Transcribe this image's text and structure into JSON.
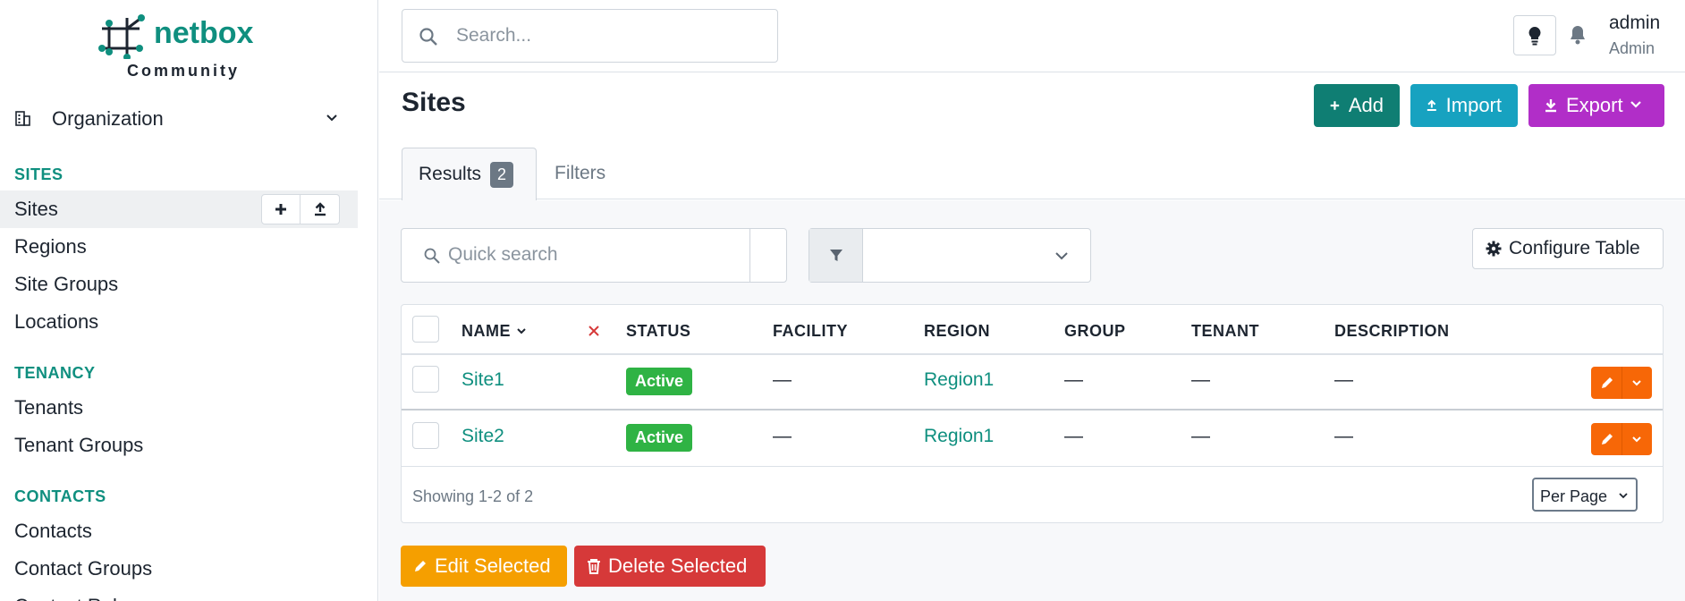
{
  "brand": {
    "name": "netbox",
    "edition": "Community"
  },
  "sidebar": {
    "org_label": "Organization",
    "sections": [
      {
        "title": "SITES",
        "items": [
          "Sites",
          "Regions",
          "Site Groups",
          "Locations"
        ]
      },
      {
        "title": "TENANCY",
        "items": [
          "Tenants",
          "Tenant Groups"
        ]
      },
      {
        "title": "CONTACTS",
        "items": [
          "Contacts",
          "Contact Groups",
          "Contact Roles"
        ]
      }
    ],
    "active_item": "Sites"
  },
  "header": {
    "search_placeholder": "Search...",
    "user_name": "admin",
    "user_role": "Admin"
  },
  "page": {
    "title": "Sites",
    "add_label": "Add",
    "import_label": "Import",
    "export_label": "Export",
    "tab_results": "Results",
    "results_count": "2",
    "tab_filters": "Filters"
  },
  "controls": {
    "quick_search_placeholder": "Quick search",
    "configure_label": "Configure Table"
  },
  "table": {
    "columns": [
      "NAME",
      "STATUS",
      "FACILITY",
      "REGION",
      "GROUP",
      "TENANT",
      "DESCRIPTION"
    ],
    "rows": [
      {
        "name": "Site1",
        "status": "Active",
        "facility": "—",
        "region": "Region1",
        "group": "—",
        "tenant": "—",
        "description": "—"
      },
      {
        "name": "Site2",
        "status": "Active",
        "facility": "—",
        "region": "Region1",
        "group": "—",
        "tenant": "—",
        "description": "—"
      }
    ],
    "showing": "Showing 1-2 of 2",
    "per_page": "Per Page"
  },
  "bulk": {
    "edit_label": "Edit Selected",
    "delete_label": "Delete Selected"
  },
  "colors": {
    "brand": "#0f8f7f",
    "add": "#0f7e73",
    "import": "#17a2c0",
    "export": "#b12ec8",
    "status_active": "#2fb344",
    "row_action": "#f76707",
    "edit_selected": "#f59f00",
    "delete_selected": "#d63939"
  }
}
